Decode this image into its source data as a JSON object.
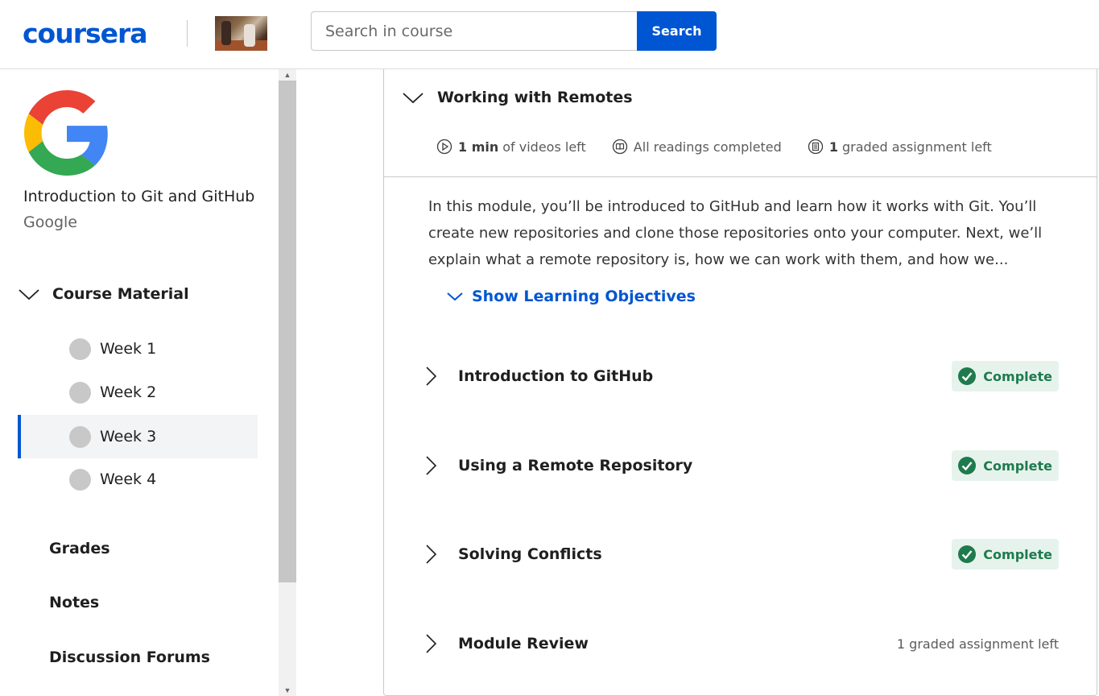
{
  "brand": {
    "name": "coursera",
    "color": "#0056d2"
  },
  "search": {
    "placeholder": "Search in course",
    "button_label": "Search"
  },
  "course": {
    "title": "Introduction to Git and GitHub",
    "partner": "Google"
  },
  "sidebar": {
    "material_label": "Course Material",
    "weeks": [
      {
        "label": "Week 1",
        "active": false
      },
      {
        "label": "Week 2",
        "active": false
      },
      {
        "label": "Week 3",
        "active": true
      },
      {
        "label": "Week 4",
        "active": false
      }
    ],
    "links": [
      {
        "label": "Grades"
      },
      {
        "label": "Notes"
      },
      {
        "label": "Discussion Forums"
      }
    ]
  },
  "module": {
    "title": "Working with Remotes",
    "stats": {
      "videos_value": "1 min",
      "videos_text": "of videos left",
      "readings_text": "All readings completed",
      "assignments_value": "1",
      "assignments_text": "graded assignment left"
    },
    "description": "In this module, you’ll be introduced to GitHub and learn how it works with Git. You’ll create new repositories and clone those repositories onto your computer. Next, we’ll explain what a remote repository is, how we can work with them, and how we...",
    "objectives_label": "Show Learning Objectives",
    "lessons": [
      {
        "title": "Introduction to GitHub",
        "status": "Complete"
      },
      {
        "title": "Using a Remote Repository",
        "status": "Complete"
      },
      {
        "title": "Solving Conflicts",
        "status": "Complete"
      },
      {
        "title": "Module Review",
        "meta": "1 graded assignment left"
      }
    ]
  }
}
